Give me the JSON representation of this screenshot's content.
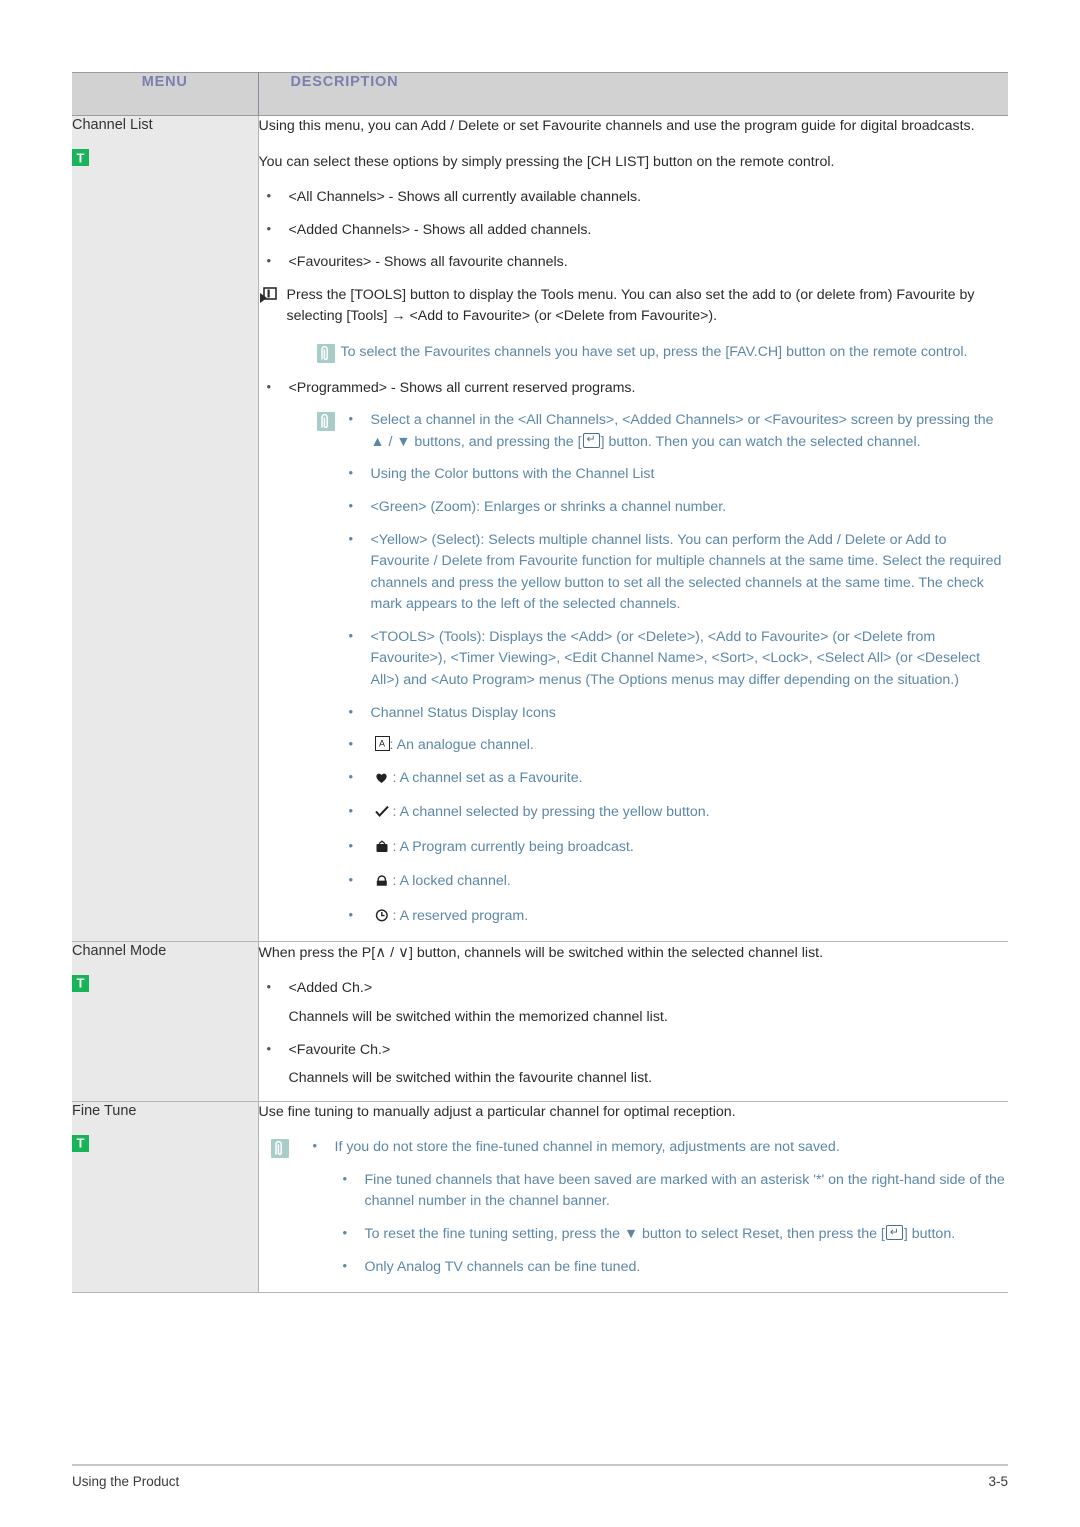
{
  "table": {
    "headers": {
      "menu": "MENU",
      "description": "DESCRIPTION"
    },
    "header_text_color": "#7a7fae",
    "header_bg": "#d2d2d2",
    "note_text_color": "#5c87a8",
    "badge_color": "#19b459",
    "note_icon_color": "#a8cdc8"
  },
  "rows": {
    "channel_list": {
      "menu_title": "Channel List",
      "badge": "T",
      "intro": "Using this menu, you can Add / Delete or set Favourite channels and use the program guide for digital broadcasts.",
      "select_line": "You can select these options by simply pressing the [CH LIST] button on the remote control.",
      "options": [
        "<All Channels> - Shows all currently available channels.",
        "<Added Channels> - Shows all added channels.",
        "<Favourites> - Shows all favourite channels."
      ],
      "tools_note": "Press the [TOOLS] button to display the Tools menu. You can also set the add to (or delete from) Favourite by selecting [Tools] → <Add to Favourite> (or <Delete from Favourite>).",
      "fav_note": "To select the Favourites channels you have set up, press the [FAV.CH] button on the remote control.",
      "programmed_option": "<Programmed> - Shows all current reserved programs.",
      "select_channel_note_a": "Select a channel in the <All Channels>, <Added Channels> or <Favourites> screen by pressing the ",
      "select_channel_note_b": " / ",
      "select_channel_note_c": " buttons, and pressing the [",
      "select_channel_note_d": "] button. Then you can watch the selected channel.",
      "arrow_up": "▲",
      "arrow_down": "▼",
      "color_buttons_heading": "Using the Color buttons with the Channel List",
      "color_buttons": [
        "<Green> (Zoom): Enlarges or shrinks a channel number.",
        "<Yellow> (Select): Selects multiple channel lists. You can perform the Add / Delete or Add to Favourite / Delete from Favourite function for multiple channels at the same time. Select the required channels and press the yellow button to set all the selected channels at the same time. The check mark appears to the left of the selected channels.",
        "<TOOLS> (Tools): Displays the <Add> (or <Delete>), <Add to Favourite> (or <Delete from Favourite>), <Timer Viewing>, <Edit Channel Name>, <Sort>, <Lock>, <Select All> (or <Deselect All>) and <Auto Program> menus (The Options menus may differ depending on the situation.)"
      ],
      "status_heading": "Channel Status Display Icons",
      "status_icons": [
        {
          "icon": "boxed-a-icon",
          "glyph": "A",
          "label": ": An analogue channel."
        },
        {
          "icon": "heart-icon",
          "glyph": "♥",
          "label": ": A channel set as a Favourite."
        },
        {
          "icon": "check-icon",
          "glyph": "✔",
          "label": ": A channel selected by pressing the yellow button."
        },
        {
          "icon": "tv-icon",
          "glyph": "📺",
          "label": ": A Program currently being broadcast."
        },
        {
          "icon": "lock-icon",
          "glyph": "🔒",
          "label": ": A locked channel."
        },
        {
          "icon": "clock-icon",
          "glyph": "🕐",
          "label": ": A reserved program."
        }
      ]
    },
    "channel_mode": {
      "menu_title": "Channel Mode",
      "badge": "T",
      "intro_a": "When press the P[",
      "chev_up": "∧",
      "intro_b": " / ",
      "chev_down": "∨",
      "intro_c": "] button, channels will be switched within the selected channel list.",
      "items": [
        {
          "title": "<Added Ch.>",
          "desc": "Channels will be switched within the memorized channel list."
        },
        {
          "title": "<Favourite Ch.>",
          "desc": "Channels will be switched within the favourite channel list."
        }
      ]
    },
    "fine_tune": {
      "menu_title": "Fine Tune",
      "badge": "T",
      "intro": "Use fine tuning to manually adjust a particular channel for optimal reception.",
      "notes": [
        "If you do not store the fine-tuned channel in memory, adjustments are not saved.",
        "Fine tuned channels that have been saved are marked with an asterisk '*' on the right-hand side of the channel number in the channel banner.",
        "Only Analog TV channels can be fine tuned."
      ],
      "reset_note_a": "To reset the fine tuning setting, press the ",
      "reset_arrow": "▼",
      "reset_note_b": " button to select Reset, then press the [",
      "reset_note_c": "] button."
    }
  },
  "footer": {
    "left": "Using the Product",
    "right": "3-5"
  }
}
